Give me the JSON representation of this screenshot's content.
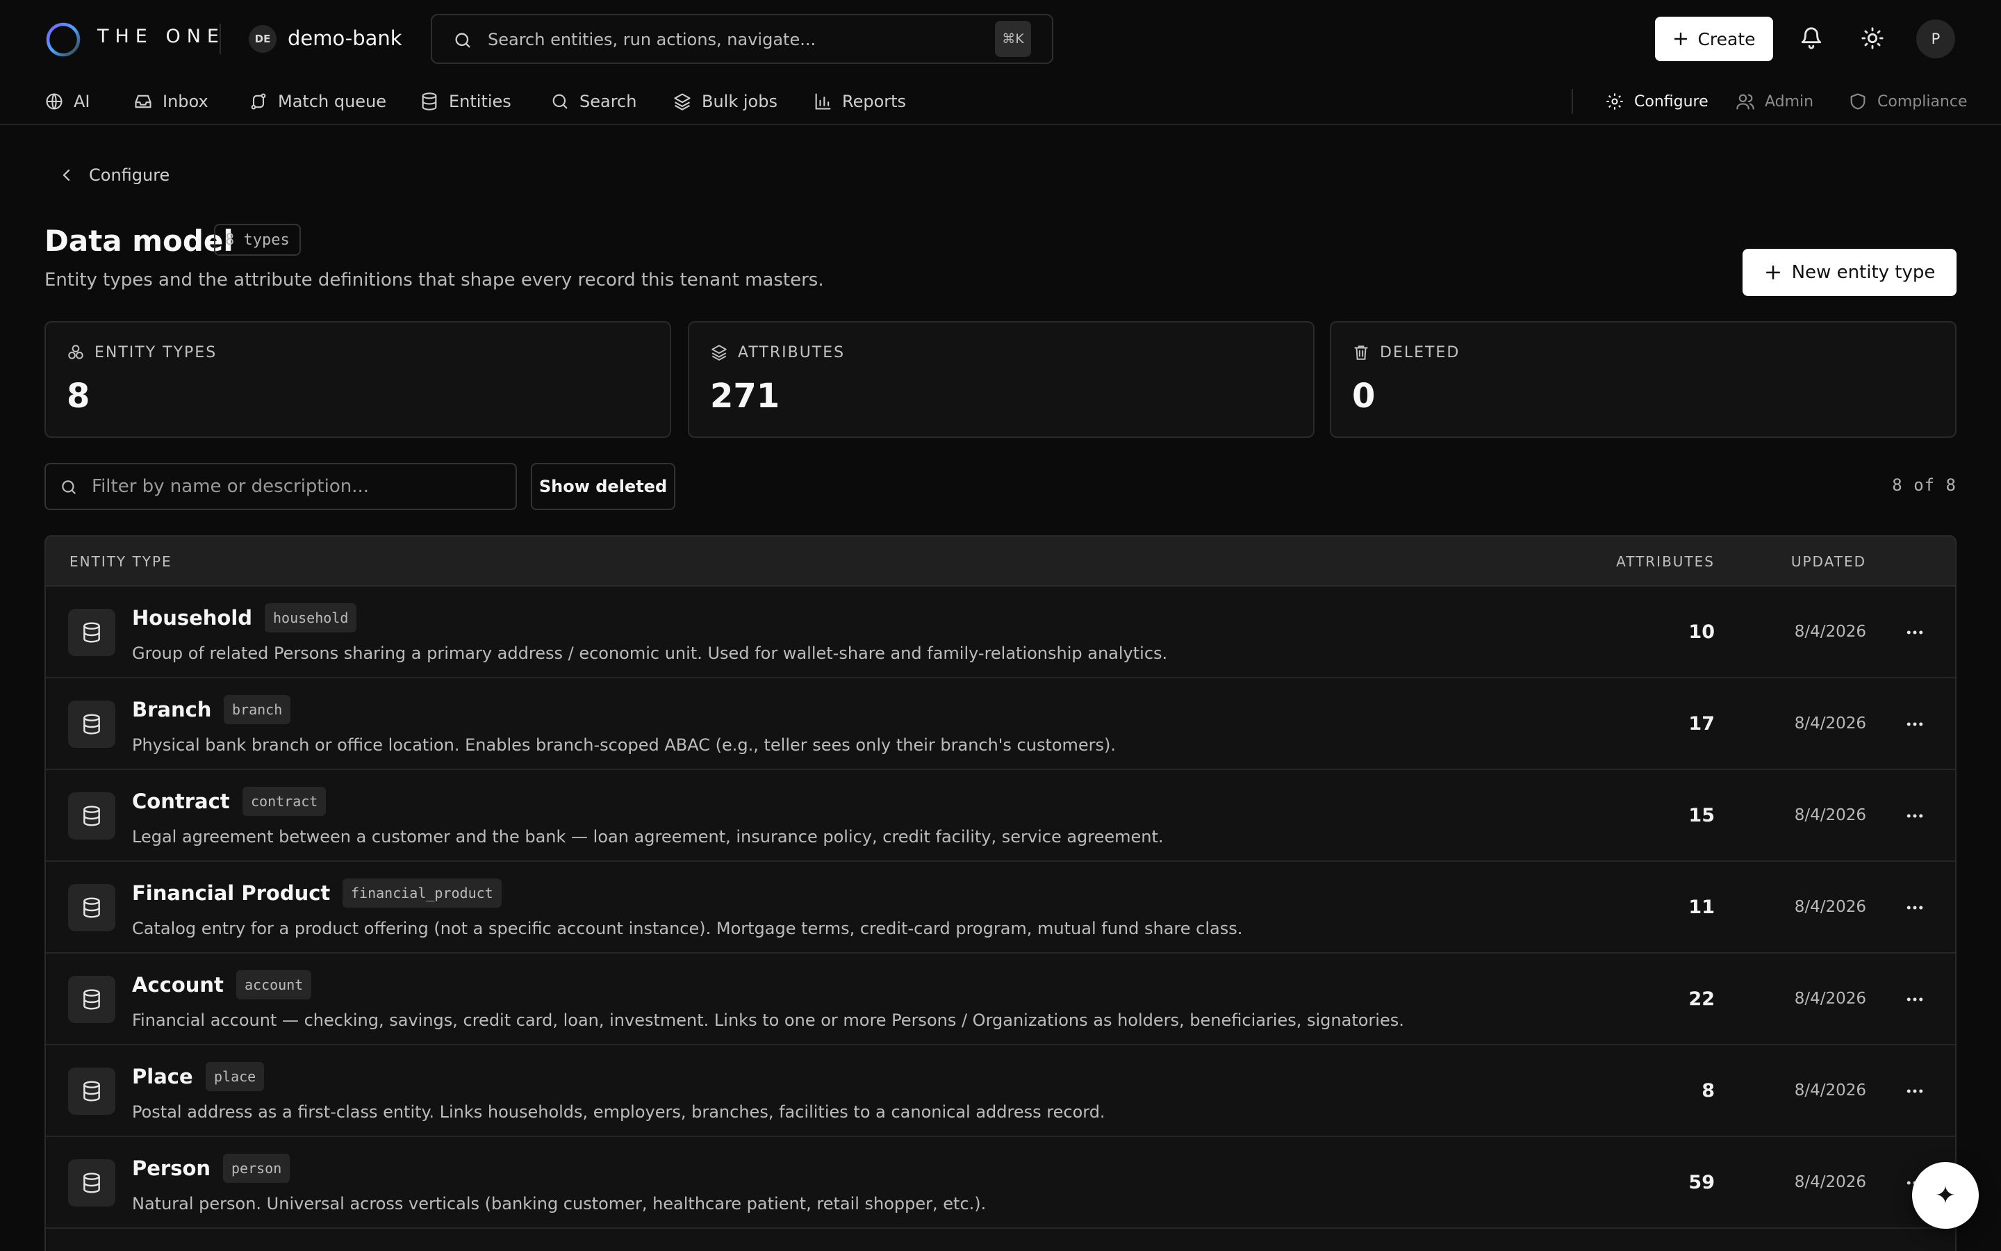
{
  "app": {
    "brand": "THE ONE",
    "tenant_initials": "DE",
    "tenant_name": "demo-bank",
    "search_placeholder": "Search entities, run actions, navigate...",
    "search_shortcut": "⌘K",
    "create_label": "Create",
    "user_initial": "P",
    "accent_color": "#7c5cff"
  },
  "nav": {
    "items": [
      {
        "label": "AI",
        "icon": "globe-icon"
      },
      {
        "label": "Inbox",
        "icon": "inbox-icon"
      },
      {
        "label": "Match queue",
        "icon": "route-icon"
      },
      {
        "label": "Entities",
        "icon": "database-icon"
      },
      {
        "label": "Search",
        "icon": "search-icon"
      },
      {
        "label": "Bulk jobs",
        "icon": "layers-icon"
      },
      {
        "label": "Reports",
        "icon": "bar-chart-icon"
      }
    ],
    "right": [
      {
        "label": "Configure",
        "icon": "gear-icon"
      },
      {
        "label": "Admin",
        "icon": "users-icon"
      },
      {
        "label": "Compliance",
        "icon": "shield-icon"
      }
    ]
  },
  "page": {
    "breadcrumb": "Configure",
    "title": "Data model",
    "count_pill": "8 types",
    "subtitle": "Entity types and the attribute definitions that shape every record this tenant masters.",
    "new_button": "New entity type"
  },
  "stats": [
    {
      "label": "ENTITY TYPES",
      "value": "8",
      "icon": "shapes-icon"
    },
    {
      "label": "ATTRIBUTES",
      "value": "271",
      "icon": "layers-icon"
    },
    {
      "label": "DELETED",
      "value": "0",
      "icon": "trash-icon"
    }
  ],
  "filter": {
    "placeholder": "Filter by name or description...",
    "show_deleted": "Show deleted",
    "result_count": "8 of 8"
  },
  "table": {
    "headers": {
      "type": "ENTITY TYPE",
      "attributes": "ATTRIBUTES",
      "updated": "UPDATED"
    },
    "rows": [
      {
        "name": "Household",
        "key": "household",
        "desc": "Group of related Persons sharing a primary address / economic unit. Used for wallet-share and family-relationship analytics.",
        "attributes": "10",
        "updated": "8/4/2026"
      },
      {
        "name": "Branch",
        "key": "branch",
        "desc": "Physical bank branch or office location. Enables branch-scoped ABAC (e.g., teller sees only their branch's customers).",
        "attributes": "17",
        "updated": "8/4/2026"
      },
      {
        "name": "Contract",
        "key": "contract",
        "desc": "Legal agreement between a customer and the bank — loan agreement, insurance policy, credit facility, service agreement.",
        "attributes": "15",
        "updated": "8/4/2026"
      },
      {
        "name": "Financial Product",
        "key": "financial_product",
        "desc": "Catalog entry for a product offering (not a specific account instance). Mortgage terms, credit-card program, mutual fund share class.",
        "attributes": "11",
        "updated": "8/4/2026"
      },
      {
        "name": "Account",
        "key": "account",
        "desc": "Financial account — checking, savings, credit card, loan, investment. Links to one or more Persons / Organizations as holders, beneficiaries, signatories.",
        "attributes": "22",
        "updated": "8/4/2026"
      },
      {
        "name": "Place",
        "key": "place",
        "desc": "Postal address as a first-class entity. Links households, employers, branches, facilities to a canonical address record.",
        "attributes": "8",
        "updated": "8/4/2026"
      },
      {
        "name": "Person",
        "key": "person",
        "desc": "Natural person. Universal across verticals (banking customer, healthcare patient, retail shopper, etc.).",
        "attributes": "59",
        "updated": "8/4/2026"
      }
    ]
  },
  "fab": {
    "glyph": "✦"
  }
}
